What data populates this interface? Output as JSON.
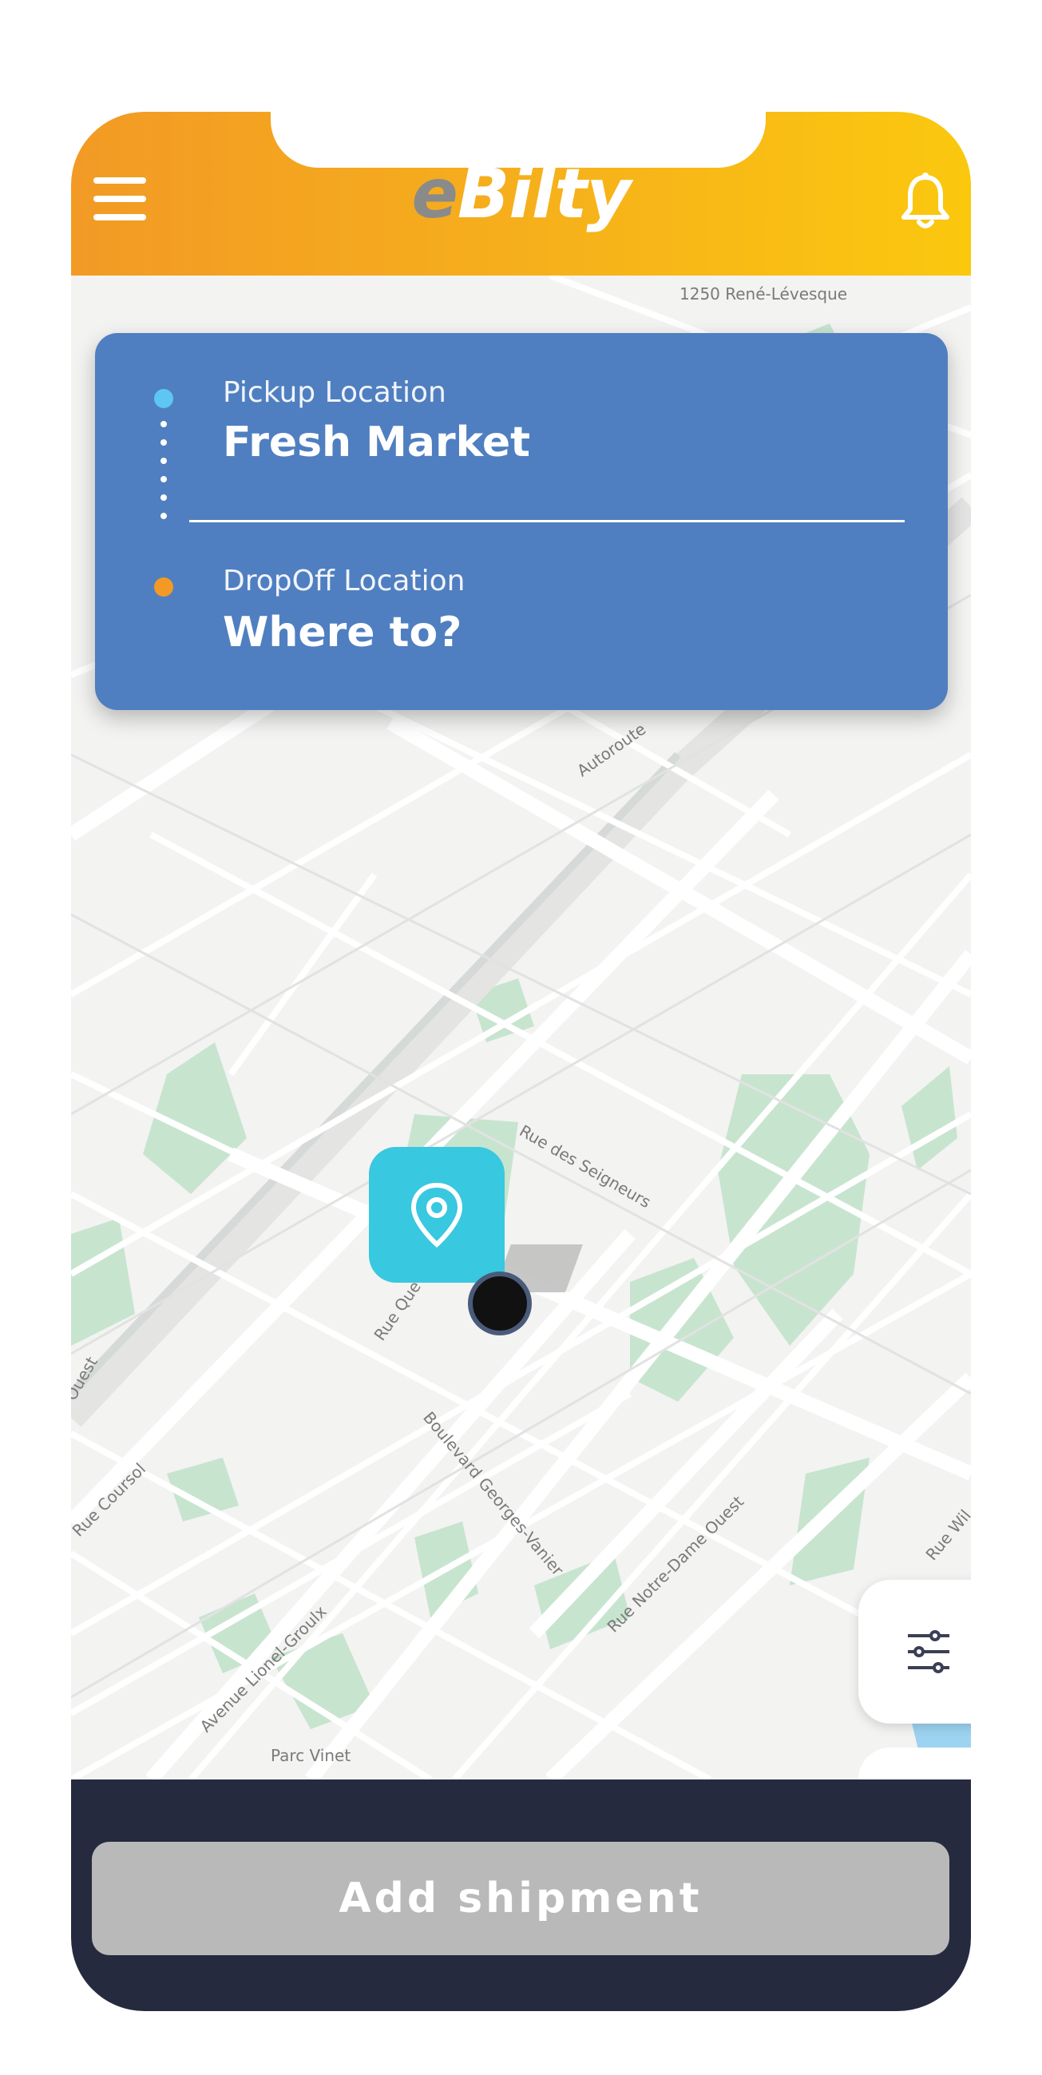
{
  "app": {
    "logo_prefix": "e",
    "logo_main": "Bilty",
    "menu_icon": "hamburger-menu-icon",
    "notification_icon": "bell-icon"
  },
  "location_card": {
    "pickup_label": "Pickup Location",
    "pickup_value": "Fresh Market",
    "dropoff_label": "DropOff Location",
    "dropoff_value": "Where to?"
  },
  "map": {
    "labels": {
      "building": "1250 René-Lévesque",
      "autoroute": "Autoroute",
      "rue_seigneurs": "Rue des Seigneurs",
      "rue_que": "Rue Que",
      "boulevard": "Boulevard Georges-Vanier",
      "notre_dame": "Rue Notre-Dame Ouest",
      "rue_coursol": "Rue Coursol",
      "avenue_lionel": "Avenue Lionel-Groulx",
      "parc_vinet": "Parc Vinet",
      "ouest": "Ouest",
      "rue_wil": "Rue Wil"
    },
    "pin_icon": "location-pin-icon",
    "filter_icon": "sliders-filter-icon"
  },
  "footer": {
    "add_shipment_label": "Add shipment"
  },
  "colors": {
    "header_start": "#f29a25",
    "header_end": "#fbc80e",
    "card": "#4f7fc0",
    "pin": "#38c8df",
    "bottom_bar": "#252a3e",
    "button_disabled": "#b9b9b9"
  }
}
